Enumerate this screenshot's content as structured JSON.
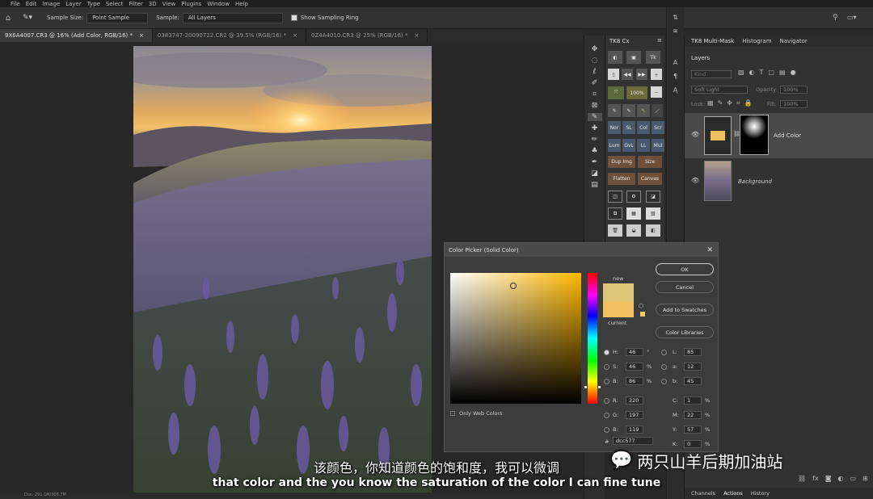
{
  "menu": [
    "File",
    "Edit",
    "Image",
    "Layer",
    "Type",
    "Select",
    "Filter",
    "3D",
    "View",
    "Plugins",
    "Window",
    "Help"
  ],
  "options": {
    "sample_size_label": "Sample Size:",
    "sample_size_value": "Point Sample",
    "sample_label": "Sample:",
    "sample_value": "All Layers",
    "show_ring": "Show Sampling Ring"
  },
  "tabs": [
    "9X6A4007.CR3 @ 16% (Add Color, RGB/16) *",
    "0383747-20090722.CR2 @ 39.5% (RGB/16) *",
    "0Z4A4010.CR3 @ 25% (RGB/16) *"
  ],
  "tk8": {
    "title": "TK8 Cx",
    "zoom": "100%",
    "row1": [
      "Nor",
      "SL",
      "Col",
      "Scr"
    ],
    "row2": [
      "Lum",
      "OvL",
      "LL",
      "Mul"
    ],
    "dup": "Dup Img",
    "size": "Size",
    "flatten": "Flatten",
    "canvas": "Canvas"
  },
  "panels": {
    "tabs": [
      "TK8 Multi-Mask",
      "Histogram",
      "Navigator"
    ],
    "layers_tab": "Layers",
    "search_placeholder": "Kind",
    "blend_mode": "Soft Light",
    "opacity_label": "Opacity:",
    "opacity_value": "100%",
    "lock_label": "Lock:",
    "fill_label": "Fill:",
    "fill_value": "100%",
    "layers": [
      "Add Color",
      "Background"
    ],
    "bottom_tabs": [
      "Channels",
      "Actions",
      "History"
    ]
  },
  "status": "Doc: 291.1M/305.7M",
  "dialog": {
    "title": "Color Picker (Solid Color)",
    "new_label": "new",
    "current_label": "current",
    "ok": "OK",
    "cancel": "Cancel",
    "add_swatches": "Add to Swatches",
    "libraries": "Color Libraries",
    "only_web": "Only Web Colors",
    "new_color": "#dcc577",
    "current_color": "#f0c060",
    "H": {
      "label": "H:",
      "value": "46",
      "unit": "°"
    },
    "S": {
      "label": "S:",
      "value": "46",
      "unit": "%"
    },
    "B": {
      "label": "B:",
      "value": "86",
      "unit": "%"
    },
    "R": {
      "label": "R:",
      "value": "220"
    },
    "G": {
      "label": "G:",
      "value": "197"
    },
    "Bl": {
      "label": "B:",
      "value": "119"
    },
    "L": {
      "label": "L:",
      "value": "85"
    },
    "a": {
      "label": "a:",
      "value": "12"
    },
    "b": {
      "label": "b:",
      "value": "45"
    },
    "C": {
      "label": "C:",
      "value": "1",
      "unit": "%"
    },
    "M": {
      "label": "M:",
      "value": "22",
      "unit": "%"
    },
    "Y": {
      "label": "Y:",
      "value": "57",
      "unit": "%"
    },
    "K": {
      "label": "K:",
      "value": "0",
      "unit": "%"
    },
    "hex_label": "#",
    "hex": "dcc577"
  },
  "subtitle_cn": "该颜色，你知道颜色的饱和度，我可以微调",
  "subtitle_en": "that color and the you know the saturation of the color I can fine tune",
  "watermark": "两只山羊后期加油站"
}
